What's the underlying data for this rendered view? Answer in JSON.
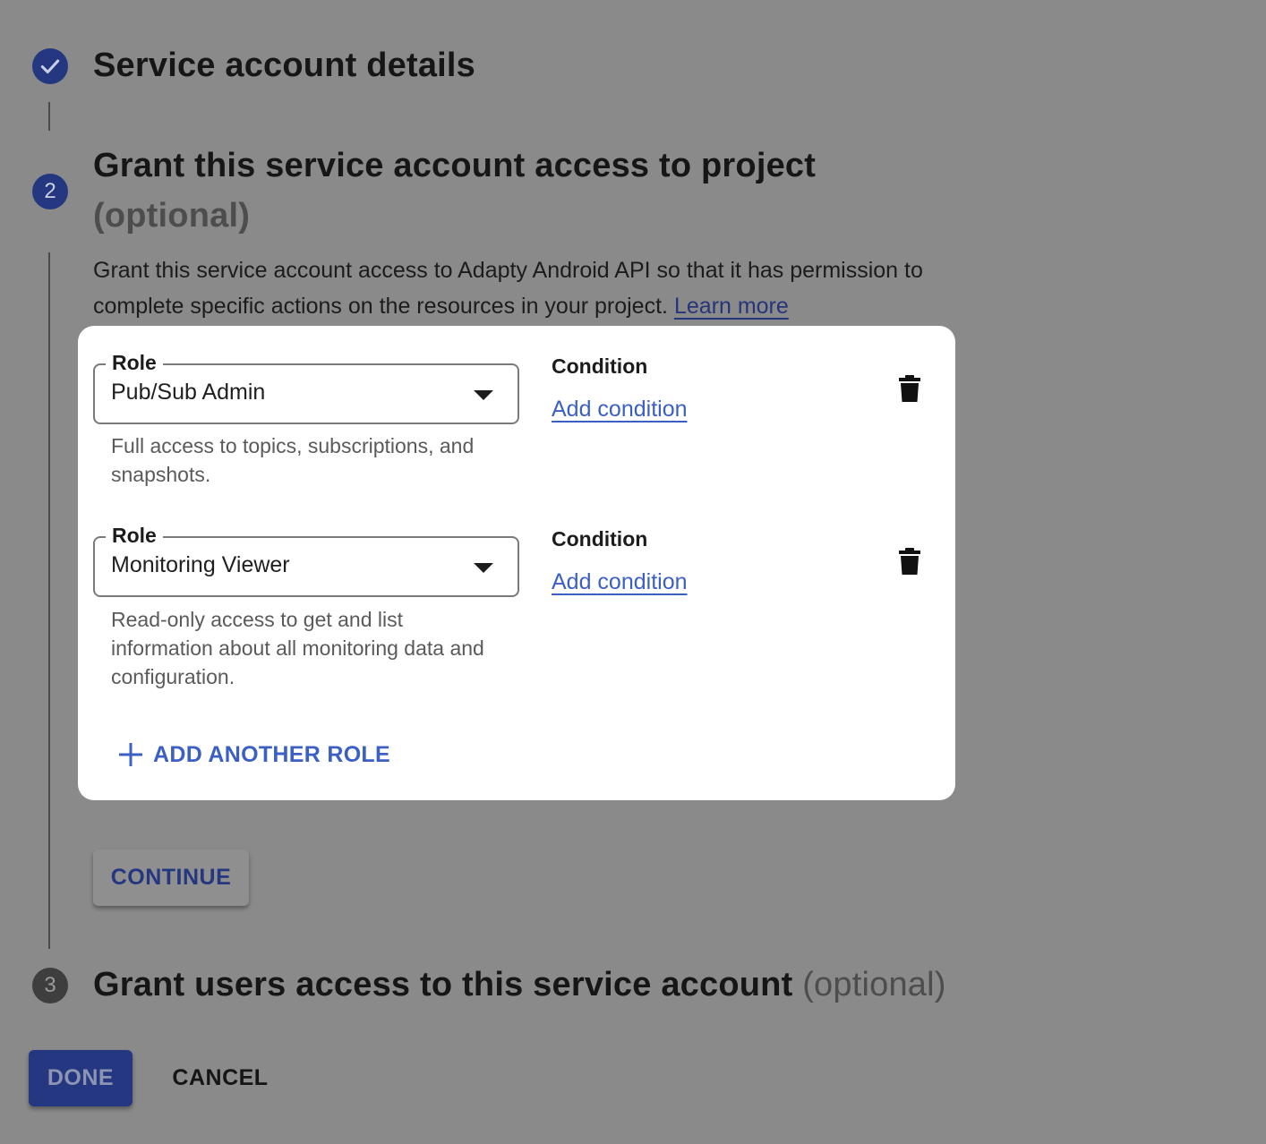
{
  "steps": [
    {
      "title": "Service account details",
      "optional": ""
    },
    {
      "number": "2",
      "title": "Grant this service account access to project",
      "optional": "(optional)",
      "description": "Grant this service account access to Adapty Android API so that it has permission to complete specific actions on the resources in your project.",
      "learn_more": "Learn more"
    },
    {
      "number": "3",
      "title": "Grant users access to this service account",
      "optional": "(optional)"
    }
  ],
  "roles": [
    {
      "label": "Role",
      "value": "Pub/Sub Admin",
      "help": "Full access to topics, subscriptions, and snapshots.",
      "condition_title": "Condition",
      "condition_link": "Add condition"
    },
    {
      "label": "Role",
      "value": "Monitoring Viewer",
      "help": "Read-only access to get and list information about all monitoring data and configuration.",
      "condition_title": "Condition",
      "condition_link": "Add condition"
    }
  ],
  "add_role_label": "ADD ANOTHER ROLE",
  "buttons": {
    "continue": "CONTINUE",
    "done": "DONE",
    "cancel": "CANCEL"
  },
  "icons": {
    "step1": "check-icon",
    "trash": "trash-icon",
    "plus": "plus-icon",
    "dropdown": "dropdown-arrow-icon"
  },
  "colors": {
    "accent": "#3c5fc4",
    "primary_dark": "#253780",
    "overlay": "#8a8a8a"
  }
}
